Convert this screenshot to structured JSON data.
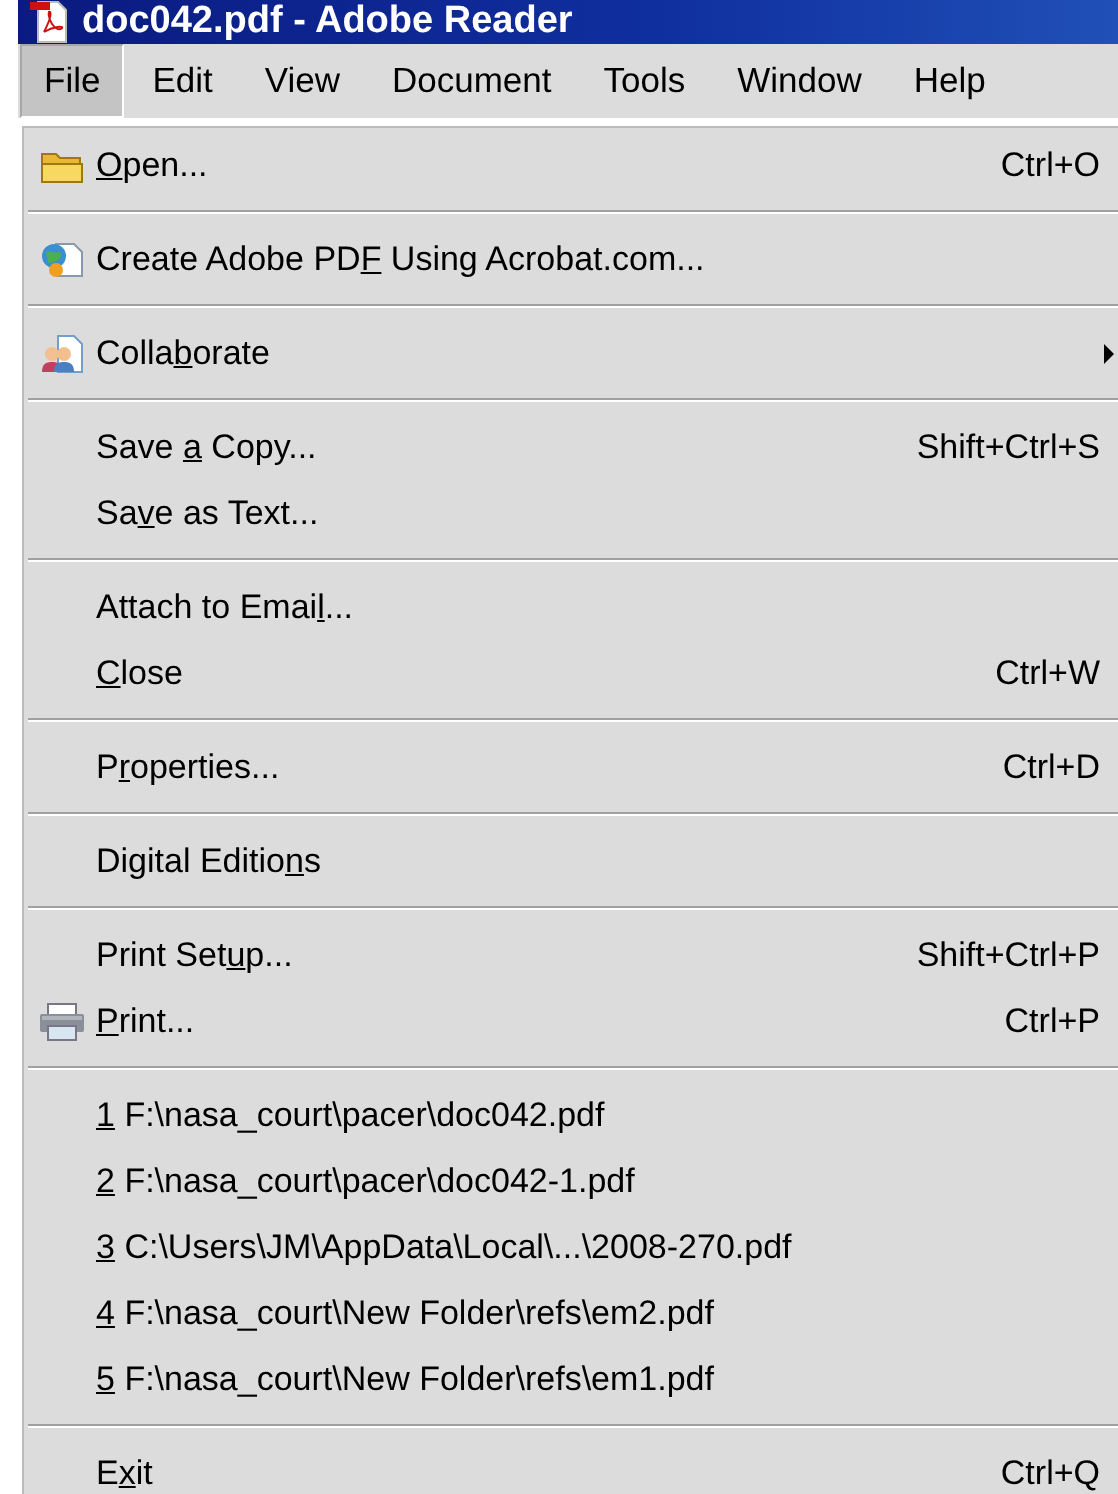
{
  "window": {
    "title": "doc042.pdf - Adobe Reader"
  },
  "menubar": [
    {
      "label": "File",
      "selected": true
    },
    {
      "label": "Edit",
      "selected": false
    },
    {
      "label": "View",
      "selected": false
    },
    {
      "label": "Document",
      "selected": false
    },
    {
      "label": "Tools",
      "selected": false
    },
    {
      "label": "Window",
      "selected": false
    },
    {
      "label": "Help",
      "selected": false
    }
  ],
  "menu": {
    "groups": [
      [
        {
          "label": {
            "key": "O",
            "after": "pen..."
          },
          "shortcut": "Ctrl+O"
        }
      ],
      [
        {
          "label": {
            "before": "Create Adobe PD",
            "key": "F",
            "after": " Using Acrobat.com..."
          }
        }
      ],
      [
        {
          "label": {
            "before": "Colla",
            "key": "b",
            "after": "orate"
          },
          "submenu": true
        }
      ],
      [
        {
          "label": {
            "before": "Save ",
            "key": "a",
            "after": " Copy..."
          },
          "shortcut": "Shift+Ctrl+S"
        },
        {
          "label": {
            "before": "Sa",
            "key": "v",
            "after": "e as Text..."
          }
        }
      ],
      [
        {
          "label": {
            "before": "Attach to Emai",
            "key": "l",
            "after": "..."
          }
        },
        {
          "label": {
            "key": "C",
            "after": "lose"
          },
          "shortcut": "Ctrl+W"
        }
      ],
      [
        {
          "label": {
            "before": "P",
            "key": "r",
            "after": "operties..."
          },
          "shortcut": "Ctrl+D"
        }
      ],
      [
        {
          "label": {
            "before": "Digital Editio",
            "key": "n",
            "after": "s"
          }
        }
      ],
      [
        {
          "label": {
            "before": "Print Set",
            "key": "u",
            "after": "p..."
          },
          "shortcut": "Shift+Ctrl+P"
        },
        {
          "label": {
            "key": "P",
            "after": "rint..."
          },
          "shortcut": "Ctrl+P"
        }
      ],
      [
        {
          "label": {
            "key": "1",
            "after": " F:\\nasa_court\\pacer\\doc042.pdf"
          }
        },
        {
          "label": {
            "key": "2",
            "after": " F:\\nasa_court\\pacer\\doc042-1.pdf"
          }
        },
        {
          "label": {
            "key": "3",
            "after": " C:\\Users\\JM\\AppData\\Local\\...\\2008-270.pdf"
          }
        },
        {
          "label": {
            "key": "4",
            "after": " F:\\nasa_court\\New Folder\\refs\\em2.pdf"
          }
        },
        {
          "label": {
            "key": "5",
            "after": " F:\\nasa_court\\New Folder\\refs\\em1.pdf"
          }
        }
      ],
      [
        {
          "label": {
            "before": "E",
            "key": "x",
            "after": "it"
          },
          "shortcut": "Ctrl+Q"
        }
      ]
    ]
  }
}
